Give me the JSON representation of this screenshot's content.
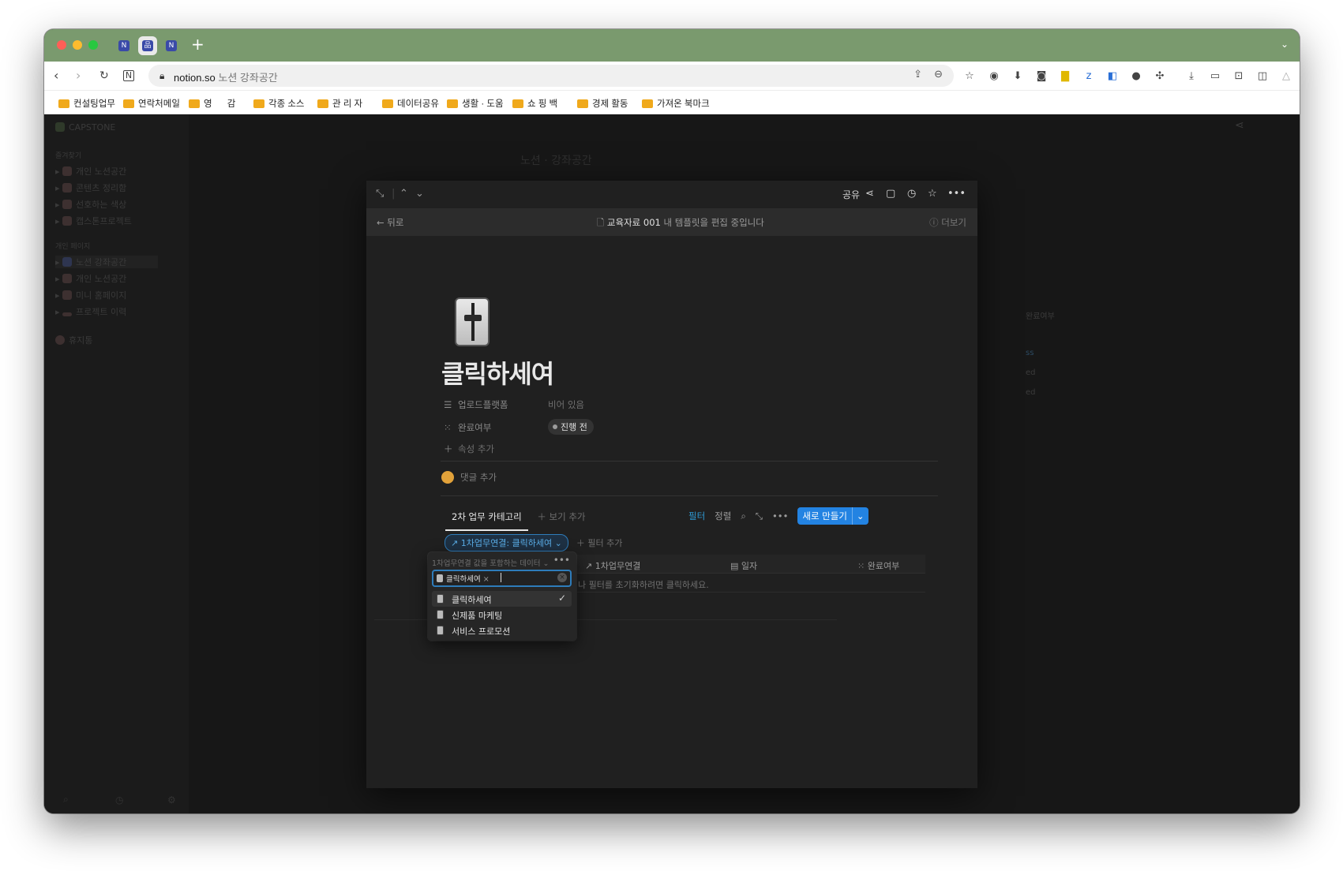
{
  "browser": {
    "tabs": [
      {
        "favicon": "N"
      },
      {
        "favicon": "品"
      },
      {
        "favicon": "N"
      }
    ],
    "new_tab": "+",
    "url": {
      "domain": "notion.so",
      "path": "노션  강좌공간"
    },
    "bookmarks": [
      "컨설팅업무",
      "연락처메일",
      "영      감",
      "각종 소스",
      "관 리 자",
      "데이터공유",
      "생활 · 도움",
      "쇼 핑 백",
      "경제 활동",
      "가져온 북마크"
    ],
    "colors": {
      "tabbar": "#7a9a6e",
      "folder": "#f0a91b"
    }
  },
  "sidebar": {
    "workspace": "CAPSTONE",
    "favorites_label": "즐겨찾기",
    "favorites": [
      "개인 노션공간",
      "콘텐츠 정리함",
      "선호하는 색상",
      "캡스톤프로젝트"
    ],
    "private_label": "개인 페이지",
    "private": [
      "노션 강좌공간",
      "개인 노션공간",
      "미니 홈페이지",
      "프로젝트 이력"
    ],
    "trash": "휴지통"
  },
  "background": {
    "title": "노션 · 강좌공간",
    "col_done": "완료여부",
    "cells": [
      "ss",
      "ed",
      "ed"
    ]
  },
  "modal": {
    "top": {
      "share": "공유"
    },
    "banner": {
      "back": "뒤로",
      "template_name": "교육자료 001",
      "template_msg": "내 템플릿을 편집 중입니다",
      "more": "더보기"
    },
    "page": {
      "title": "클릭하세여",
      "properties": [
        {
          "icon": "list-icon",
          "name": "업로드플랫폼",
          "value": "비어 있음"
        },
        {
          "icon": "status-icon",
          "name": "완료여부",
          "value": "진행 전"
        }
      ],
      "add_property": "속성 추가",
      "add_comment": "댓글 추가"
    },
    "database": {
      "view_tab": "2차 업무 카테고리",
      "add_view": "보기 추가",
      "filter": "필터",
      "sort": "정렬",
      "new_button": "새로 만들기",
      "filter_chip": "1차업무연결: 클릭하세여",
      "add_filter": "필터 추가",
      "columns": [
        "1차업무연결",
        "일자",
        "완료여부"
      ],
      "empty_message": "나 필터를 초기화하려면 클릭하세요."
    },
    "dropdown": {
      "header": "1차업무연결 값을 포함하는 데이터",
      "token": "클릭하세여",
      "options": [
        {
          "label": "클릭하세여",
          "selected": true
        },
        {
          "label": "신제품 마케팅",
          "selected": false
        },
        {
          "label": "서비스 프로모션",
          "selected": false
        }
      ]
    },
    "colors": {
      "accent": "#2383e2",
      "filter_chip": "#5aaee8",
      "modal_bg": "#202020"
    }
  }
}
